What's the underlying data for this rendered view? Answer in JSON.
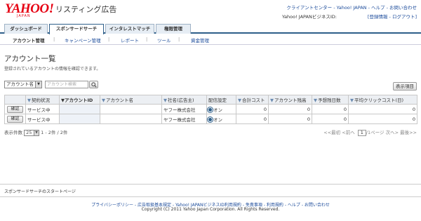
{
  "header": {
    "logo_text": "YAHOO!",
    "logo_sub": "JAPAN",
    "title": "リスティング広告",
    "top_links": [
      "クライアントセンター",
      "Yahoo! JAPAN",
      "ヘルプ",
      "お問い合わせ"
    ],
    "business_id_label": "Yahoo! JAPANビジネスID:",
    "account_links": [
      "[登録情報",
      "ログアウト]"
    ]
  },
  "tabs": [
    {
      "label": "ダッシュボード"
    },
    {
      "label": "スポンサードサーチ"
    },
    {
      "label": "インタレストマッチ"
    },
    {
      "label": "権限管理"
    }
  ],
  "subnav": [
    {
      "label": "アカウント管理"
    },
    {
      "label": "キャンペーン管理"
    },
    {
      "label": "レポート"
    },
    {
      "label": "ツール"
    },
    {
      "label": "資金管理"
    }
  ],
  "page": {
    "title": "アカウント一覧",
    "description": "登録されているアカウントの情報を確認できます。"
  },
  "filter": {
    "field_select": "アカウント名",
    "search_placeholder": "アカウント検索",
    "display_items_button": "表示項目"
  },
  "table": {
    "columns": [
      "",
      "契約状況",
      "アカウントID",
      "アカウント名",
      "社名(広告主)",
      "配信設定",
      "合計コスト",
      "アカウント残高",
      "予想残日数",
      "平均クリックコスト(日)"
    ],
    "rows": [
      {
        "button": "確認",
        "status": "サービス中",
        "account_id": "",
        "account_name": "",
        "company": "ヤフー株式会社",
        "delivery": "オン",
        "total_cost": "0",
        "balance": "0",
        "days_left": "0",
        "avg_cpc": "0"
      },
      {
        "button": "確認",
        "status": "サービス中",
        "account_id": "",
        "account_name": "",
        "company": "ヤフー株式会社",
        "delivery": "オン",
        "total_cost": "0",
        "balance": "0",
        "days_left": "0",
        "avg_cpc": "0"
      }
    ]
  },
  "pager": {
    "per_page_label": "表示件数",
    "per_page_value": "25",
    "range": "1 - 2件 / 2件",
    "first": "<<最初",
    "prev": "<前へ",
    "page_value": "1",
    "page_total": "/1ページ",
    "next": "次へ>",
    "last": "最後>>"
  },
  "footer": {
    "start_page": "スポンサードサーチのスタートページ",
    "links": [
      "プライバシーポリシー",
      "広告取扱基本規定",
      "Yahoo! JAPANビジネスID利用規約",
      "免責事項",
      "利用規約",
      "ヘルプ",
      "お問い合わせ"
    ],
    "copyright": "Copyright (C) 2011 Yahoo Japan Corporation. All Rights Reserved."
  }
}
